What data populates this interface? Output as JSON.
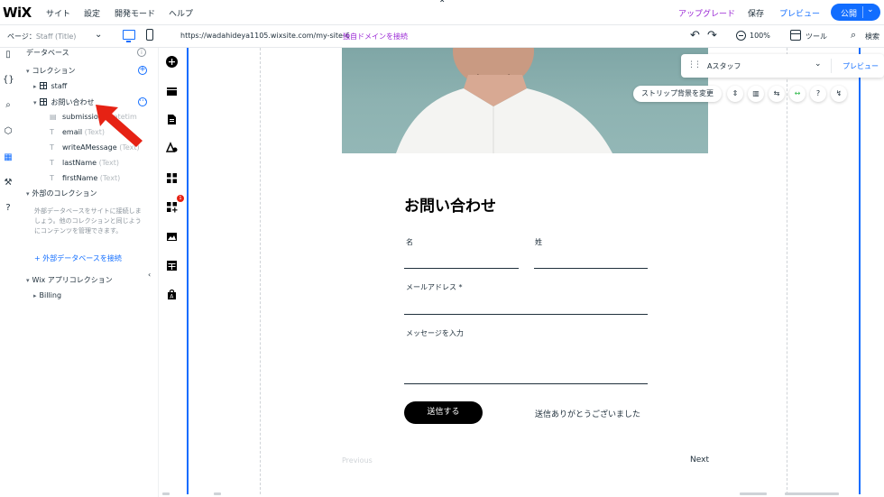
{
  "topbar": {
    "logo": "WiX",
    "menu": [
      "サイト",
      "設定",
      "開発モード",
      "ヘルプ"
    ],
    "collapse": "⌃",
    "upgrade": "アップグレード",
    "save": "保存",
    "preview": "プレビュー",
    "publish": "公開"
  },
  "toolbar": {
    "page_prefix": "ページ：",
    "page_name": "Staff (Title)",
    "url": "https://wadahideya1105.wixsite.com/my-site-6",
    "connect_domain": "独自ドメインを接続",
    "zoom": "100%",
    "tools": "ツール",
    "search": "検索"
  },
  "panel": {
    "title": "データベース",
    "collections_header": "コレクション",
    "collections": [
      {
        "name": "staff"
      },
      {
        "name": "お問い合わせ"
      }
    ],
    "fields": [
      {
        "name": "submission",
        "type": "(Datetim"
      },
      {
        "name": "email",
        "type": "(Text)"
      },
      {
        "name": "writeAMessage",
        "type": "(Text)"
      },
      {
        "name": "lastName",
        "type": "(Text)"
      },
      {
        "name": "firstName",
        "type": "(Text)"
      }
    ],
    "external_header": "外部のコレクション",
    "external_desc": "外部データベースをサイトに接続しましょう。他のコレクションと同じようにコンテンツを管理できます。",
    "external_link": "+ 外部データベースを接続",
    "wix_apps_header": "Wix アプリコレクション",
    "wix_apps": [
      {
        "name": "Billing"
      }
    ]
  },
  "addstrip": {
    "icons": [
      "add-icon",
      "sections-icon",
      "pages-icon",
      "design-icon",
      "apps-icon",
      "add-apps-icon",
      "media-icon",
      "cms-icon",
      "business-icon"
    ],
    "badge": "1"
  },
  "canvas": {
    "form_title": "お問い合わせ",
    "first_name_label": "名",
    "last_name_label": "姓",
    "email_label": "メールアドレス *",
    "message_label": "メッセージを入力",
    "submit": "送信する",
    "thanks": "送信ありがとうございました",
    "previous": "Previous",
    "next": "Next"
  },
  "repeater": {
    "dataset": "Aスタッフ",
    "preview": "プレビュー",
    "strip_bg": "ストリップ背景を変更"
  },
  "colors": {
    "accent": "#116dff",
    "upgrade": "#9a27d5",
    "annotation": "#e62214"
  }
}
